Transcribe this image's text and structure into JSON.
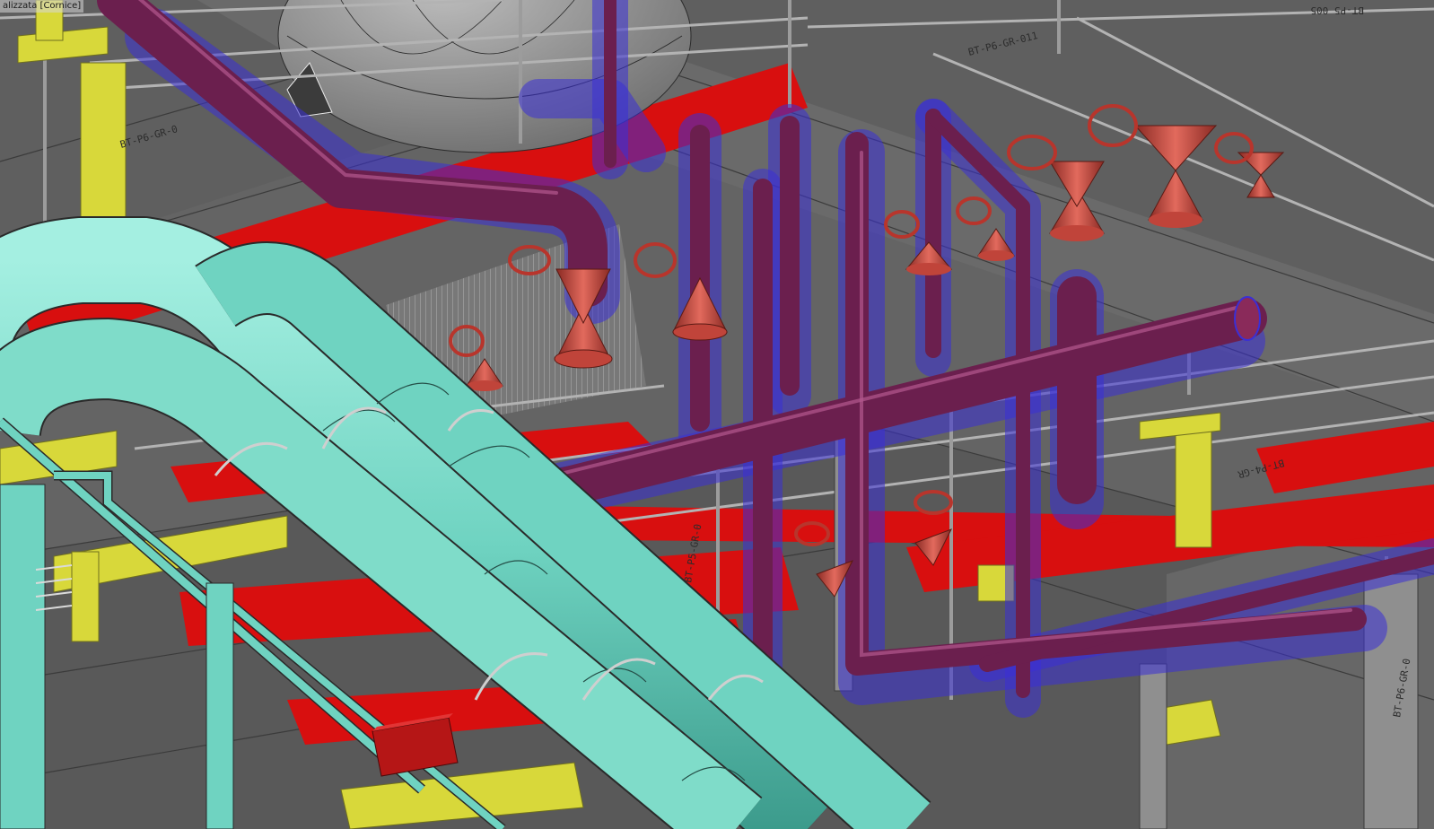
{
  "viewport": {
    "label": "alizzata [Cornice]",
    "background": "#5c5c5c"
  },
  "colors": {
    "pipe_teal": "#6fd3c1",
    "pipe_maroon": "#6b1f4e",
    "insulation_blue": "#3a2fd6",
    "valve_red": "#c0443a",
    "floor_red": "#d80f0f",
    "support_yellow": "#d8d83a",
    "grating_grey": "#8c8c8c",
    "railing_grey": "#b3b3b3"
  },
  "labels": {
    "grid_label_top": "BT-P6-GR-011",
    "grid_label_corner": "BT-P5 005",
    "grid_label_right": "BT-P4-GR",
    "grid_label_left": "BT-P6-GR-0",
    "grid_label_left_lower": "BT-P5-GR-0",
    "grid_label_corner_right": "BT-P6-GR-0"
  }
}
